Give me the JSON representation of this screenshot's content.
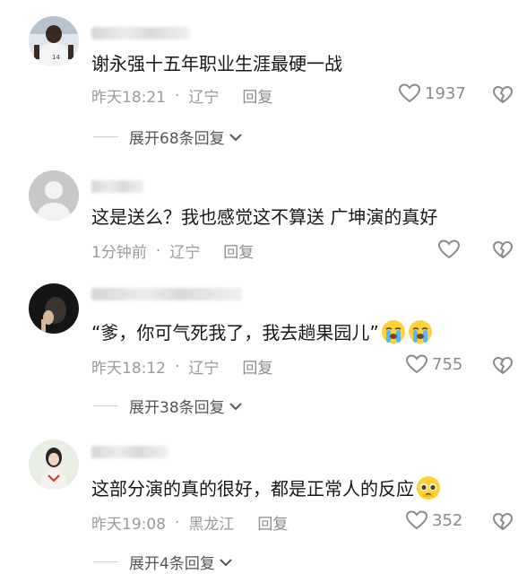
{
  "comments": [
    {
      "text": "谢永强十五年职业生涯最硬一战",
      "time": "昨天18:21",
      "location": "辽宁",
      "reply_label": "回复",
      "likes": "1937",
      "expand_label": "展开68条回复"
    },
    {
      "text": "这是送么？我也感觉这不算送 广坤演的真好",
      "time": "1分钟前",
      "location": "辽宁",
      "reply_label": "回复",
      "likes": ""
    },
    {
      "text": "“爹，你可气死我了，我去趟果园儿”",
      "time": "昨天18:12",
      "location": "辽宁",
      "reply_label": "回复",
      "likes": "755",
      "expand_label": "展开38条回复",
      "emoji": [
        "crying-face",
        "crying-face"
      ]
    },
    {
      "text": "这部分演的真的很好，都是正常人的反应",
      "time": "昨天19:08",
      "location": "黑龙江",
      "reply_label": "回复",
      "likes": "352",
      "expand_label": "展开4条回复",
      "emoji": [
        "pleading-face"
      ]
    }
  ],
  "separator": "·",
  "colors": {
    "text": "#161616",
    "meta": "#9a9a9a",
    "icon": "#8a8a8a"
  }
}
